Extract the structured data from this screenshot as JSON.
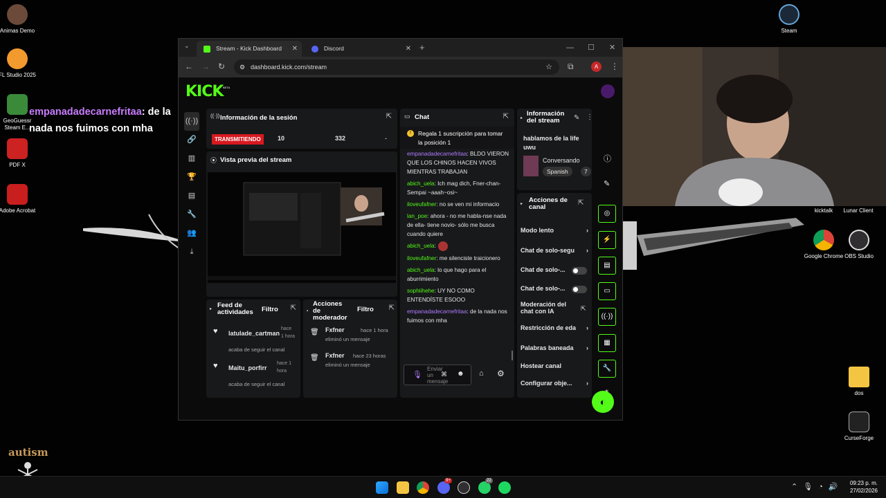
{
  "desktop": {
    "icons_left": [
      {
        "label": "Animas Demo",
        "color": "#6b4a3a"
      },
      {
        "label": "FL Studio 2025",
        "color": "#f29a2e"
      },
      {
        "label": "GeoGuessr Steam E...",
        "color": "#3a8a3a"
      },
      {
        "label": "PDF X",
        "color": "#cc2222"
      },
      {
        "label": "Adobe Acrobat",
        "color": "#c81e1e"
      }
    ],
    "icons_right": [
      {
        "label": "Steam",
        "color": "#1b2838"
      },
      {
        "label": "kicktalk",
        "color": "#222"
      },
      {
        "label": "Lunar Client",
        "color": "#222"
      },
      {
        "label": "Google Chrome",
        "color": "#db4437"
      },
      {
        "label": "OBS Studio",
        "color": "#302e31"
      },
      {
        "label": "dos",
        "color": "#f4c542"
      },
      {
        "label": "CurseForge",
        "color": "#222"
      }
    ],
    "overlay_user": "empanadadecarnefritaa",
    "overlay_text1": ": de la",
    "overlay_text2": "nada nos fuimos con mha",
    "sticker_text": "autism"
  },
  "browser": {
    "tabs": [
      {
        "label": "Stream - Kick Dashboard",
        "color": "#53fc18"
      },
      {
        "label": "Discord",
        "color": "#5865f2"
      }
    ],
    "url": "dashboard.kick.com/stream",
    "profile_letter": "A"
  },
  "kick": {
    "logo": "KICK",
    "beta": "BETA",
    "session": {
      "title": "Información de la sesión",
      "status": "TRANSMITIENDO",
      "viewers": "10",
      "followers": "332",
      "dash": "-"
    },
    "preview_title": "Vista previa del stream",
    "feed": {
      "title": "Feed de actividades",
      "filter": "Filtro",
      "items": [
        {
          "user": "latulade_cartman",
          "time": "hace 1 hora",
          "action": "acaba de seguir el canal"
        },
        {
          "user": "Maitu_porfirr",
          "time": "hace 1 hora",
          "action": "acaba de seguir el canal"
        }
      ]
    },
    "mod": {
      "title": "Acciones de moderador",
      "filter": "Filtro",
      "items": [
        {
          "user": "Fxfner",
          "time": "hace 1 hora",
          "action": "eliminó un mensaje"
        },
        {
          "user": "Fxfner",
          "time": "hace 23 horas",
          "action": "eliminó un mensaje"
        }
      ]
    },
    "chat": {
      "title": "Chat",
      "pinned": "Regala 1 suscripción para tomar la posición 1",
      "messages": [
        {
          "user": "empanadadecarnefritaa",
          "text": ": BLDO VIERON QUE LOS CHINOS HACEN VIVOS MIENTRAS TRABAJAN",
          "color": "#b07cff"
        },
        {
          "user": "abich_uela",
          "text": ": Ich mag dich, Fner-chan-Sempai ~aaah~osi~",
          "color": "#53fc18"
        },
        {
          "user": "iloveufafner",
          "text": ": no se ven mi informacio",
          "color": "#53fc18"
        },
        {
          "user": "lan_poe",
          "text": ": ahora - no me habla-nse nada de ella- tiene novio- sólo me busca cuando quiere",
          "color": "#53fc18"
        },
        {
          "user": "abich_uela",
          "text": ":",
          "color": "#53fc18"
        },
        {
          "user": "iloveufafner",
          "text": ": me silenciste traicionero",
          "color": "#53fc18"
        },
        {
          "user": "abich_uela",
          "text": ": lo que hago para el aburrimiento",
          "color": "#53fc18"
        },
        {
          "user": "sophiihehe",
          "text": ": UY NO COMO ENTENDÍSTE ESOOO",
          "color": "#53fc18"
        },
        {
          "user": "empanadadecarnefritaa",
          "text": ": de la nada nos fuimos con mha",
          "color": "#b07cff"
        }
      ],
      "input_placeholder": "Enviar un mensaje"
    },
    "stream_info": {
      "title": "Información del stream",
      "stream_title": "hablamos de la life uwu",
      "category": "Conversando",
      "language": "Spanish",
      "more": "7"
    },
    "channel_actions": {
      "title": "Acciones de canal",
      "items": [
        {
          "label": "Modo lento",
          "kind": "chevron"
        },
        {
          "label": "Chat de solo-segu",
          "kind": "chevron"
        },
        {
          "label": "Chat de solo-...",
          "kind": "toggle"
        },
        {
          "label": "Chat de solo-...",
          "kind": "toggle"
        },
        {
          "label": "Moderación del chat con IA",
          "kind": "external"
        },
        {
          "label": "Restricción de eda",
          "kind": "chevron"
        },
        {
          "label": "Palabras baneada",
          "kind": "chevron"
        },
        {
          "label": "Hostear canal",
          "kind": "none"
        },
        {
          "label": "Configurar obje...",
          "kind": "chevron"
        }
      ]
    }
  },
  "taskbar": {
    "time": "09:23 p. m.",
    "date": "27/02/2026",
    "badge_discord": "9+",
    "badge_whatsapp": "22"
  }
}
